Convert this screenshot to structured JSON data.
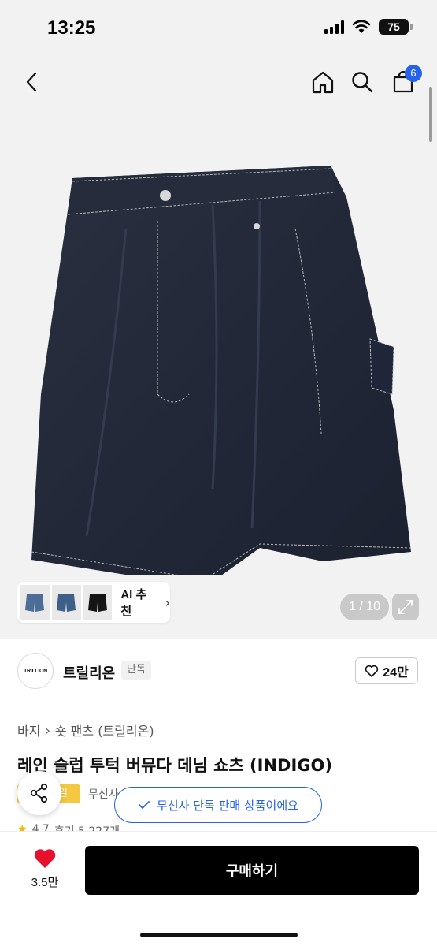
{
  "status_bar": {
    "time": "13:25",
    "battery": "75"
  },
  "nav": {
    "cart_count": "6"
  },
  "gallery": {
    "ai_label": "AI 추천",
    "pager": "1 / 10"
  },
  "brand": {
    "logo_text": "TRILLION",
    "name": "트릴리온",
    "tag": "단독",
    "like_count": "24만"
  },
  "breadcrumb": {
    "category": "바지",
    "subcategory": "숏 팬츠 (트릴리온)"
  },
  "product": {
    "title": "레인 슬럽 투턱 버뮤다 데님 쇼츠 (INDIGO)",
    "tag_text": "일",
    "meta_text": "무신사"
  },
  "toast": {
    "text": "무신사 단독 판매 상품이에요"
  },
  "rating": {
    "score": "4.7",
    "reviews": "후기 5,227개"
  },
  "bottom_bar": {
    "likes": "3.5만",
    "buy_label": "구매하기"
  },
  "colors": {
    "accent_blue": "#2563eb",
    "like_red": "#e8112d",
    "buy_black": "#000000"
  }
}
